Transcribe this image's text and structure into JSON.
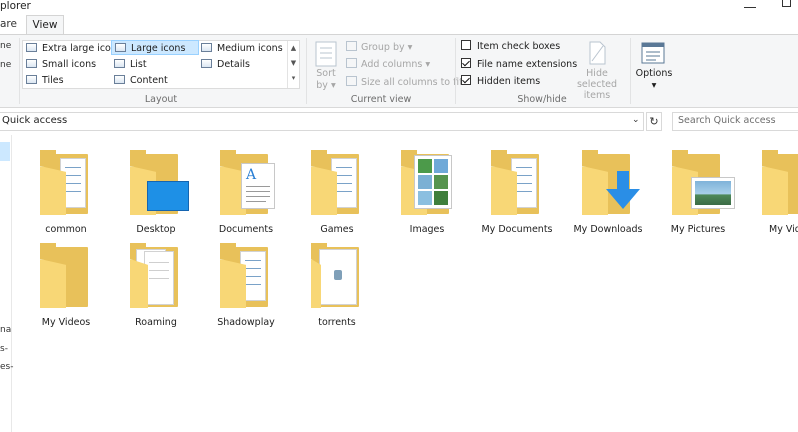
{
  "window": {
    "title": "plorer",
    "minimize": "—",
    "maximize": "☐"
  },
  "tabs": {
    "share": "are",
    "view": "View"
  },
  "ribbon": {
    "nav_pane_partial": [
      "ne",
      "ne"
    ],
    "layout": {
      "label": "Layout",
      "items": [
        "Extra large icons",
        "Large icons",
        "Medium icons",
        "Small icons",
        "List",
        "Details",
        "Tiles",
        "Content"
      ]
    },
    "current_view": {
      "label": "Current view",
      "sort_by": "Sort by",
      "group_by": "Group by",
      "add_columns": "Add columns",
      "size_all_columns": "Size all columns to fit"
    },
    "show_hide": {
      "label": "Show/hide",
      "item_check_boxes": "Item check boxes",
      "file_name_extensions": "File name extensions",
      "hidden_items": "Hidden items",
      "hide_selected_items": "Hide selected items"
    },
    "options": {
      "label": "Options"
    }
  },
  "address": {
    "path": "Quick access",
    "search_placeholder": "Search Quick access"
  },
  "nav_partial": [
    "na",
    "s-",
    "es-"
  ],
  "items": [
    {
      "name": "common"
    },
    {
      "name": "Desktop"
    },
    {
      "name": "Documents"
    },
    {
      "name": "Games"
    },
    {
      "name": "Images"
    },
    {
      "name": "My Documents"
    },
    {
      "name": "My Downloads"
    },
    {
      "name": "My Pictures"
    },
    {
      "name": "My Vid"
    },
    {
      "name": "My Videos"
    },
    {
      "name": "Roaming"
    },
    {
      "name": "Shadowplay"
    },
    {
      "name": "torrents"
    }
  ],
  "colors": {
    "folder_front": "#f8d776",
    "folder_back": "#e8c15a",
    "selection": "#cce8ff",
    "desktop_blue": "#1e90e6",
    "download_arrow": "#2a8ee6"
  }
}
